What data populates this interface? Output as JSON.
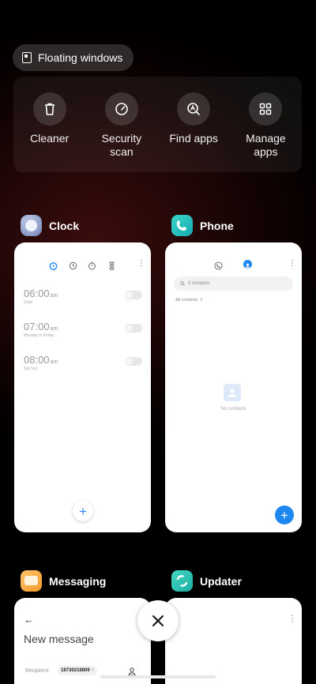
{
  "floating_windows": {
    "label": "Floating windows",
    "icon": "floating-window-icon"
  },
  "tools": [
    {
      "label": "Cleaner",
      "icon": "trash-icon"
    },
    {
      "label": "Security scan",
      "icon": "gauge-icon"
    },
    {
      "label": "Find apps",
      "icon": "search-apps-icon"
    },
    {
      "label": "Manage apps",
      "icon": "grid-icon"
    }
  ],
  "apps": {
    "clock": {
      "name": "Clock",
      "alarms": [
        {
          "time": "06:00",
          "ampm": "am",
          "label": "Daily"
        },
        {
          "time": "07:00",
          "ampm": "am",
          "label": "Monday to Friday"
        },
        {
          "time": "08:00",
          "ampm": "am",
          "label": "Sat Sun"
        }
      ]
    },
    "phone": {
      "name": "Phone",
      "search_placeholder": "0 contacts",
      "filter": "All contacts",
      "empty": "No contacts"
    },
    "messaging": {
      "name": "Messaging",
      "back": "←",
      "title": "New message",
      "recipient_label": "Recipient:",
      "recipient_chip": "18730218809"
    },
    "updater": {
      "name": "Updater"
    }
  },
  "colors": {
    "accent": "#1e88f0"
  }
}
